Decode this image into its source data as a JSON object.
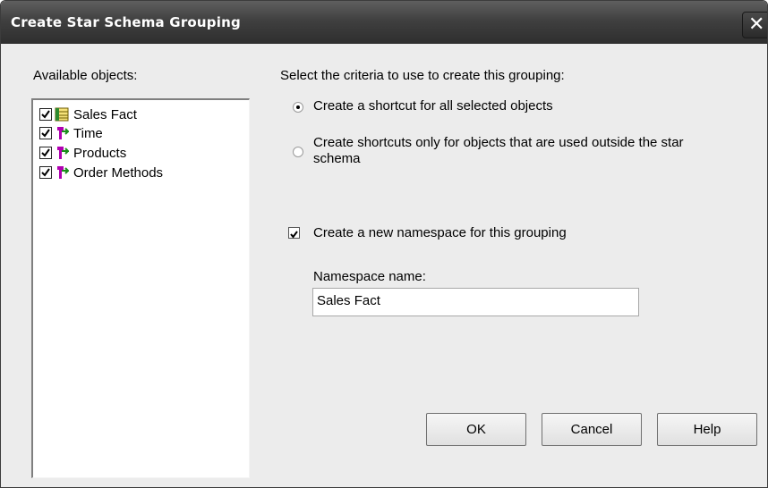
{
  "window": {
    "title": "Create Star Schema Grouping",
    "close_glyph": "✕"
  },
  "left_panel": {
    "label": "Available objects:",
    "items": [
      {
        "label": "Sales Fact",
        "checked": true,
        "icon": "fact-table-icon"
      },
      {
        "label": "Time",
        "checked": true,
        "icon": "dimension-icon"
      },
      {
        "label": "Products",
        "checked": true,
        "icon": "dimension-icon"
      },
      {
        "label": "Order Methods",
        "checked": true,
        "icon": "dimension-icon"
      }
    ]
  },
  "criteria": {
    "label": "Select the criteria to use to create this grouping:",
    "options": [
      {
        "label": "Create a shortcut for all selected objects",
        "selected": true
      },
      {
        "label_line1": "Create shortcuts only for objects that are used outside the star",
        "label_line2": "schema",
        "selected": false
      }
    ]
  },
  "namespace": {
    "checkbox_label": "Create a new namespace for this grouping",
    "checked": true,
    "name_label": "Namespace name:",
    "name_value": "Sales Fact"
  },
  "buttons": {
    "ok": "OK",
    "cancel": "Cancel",
    "help": "Help"
  }
}
